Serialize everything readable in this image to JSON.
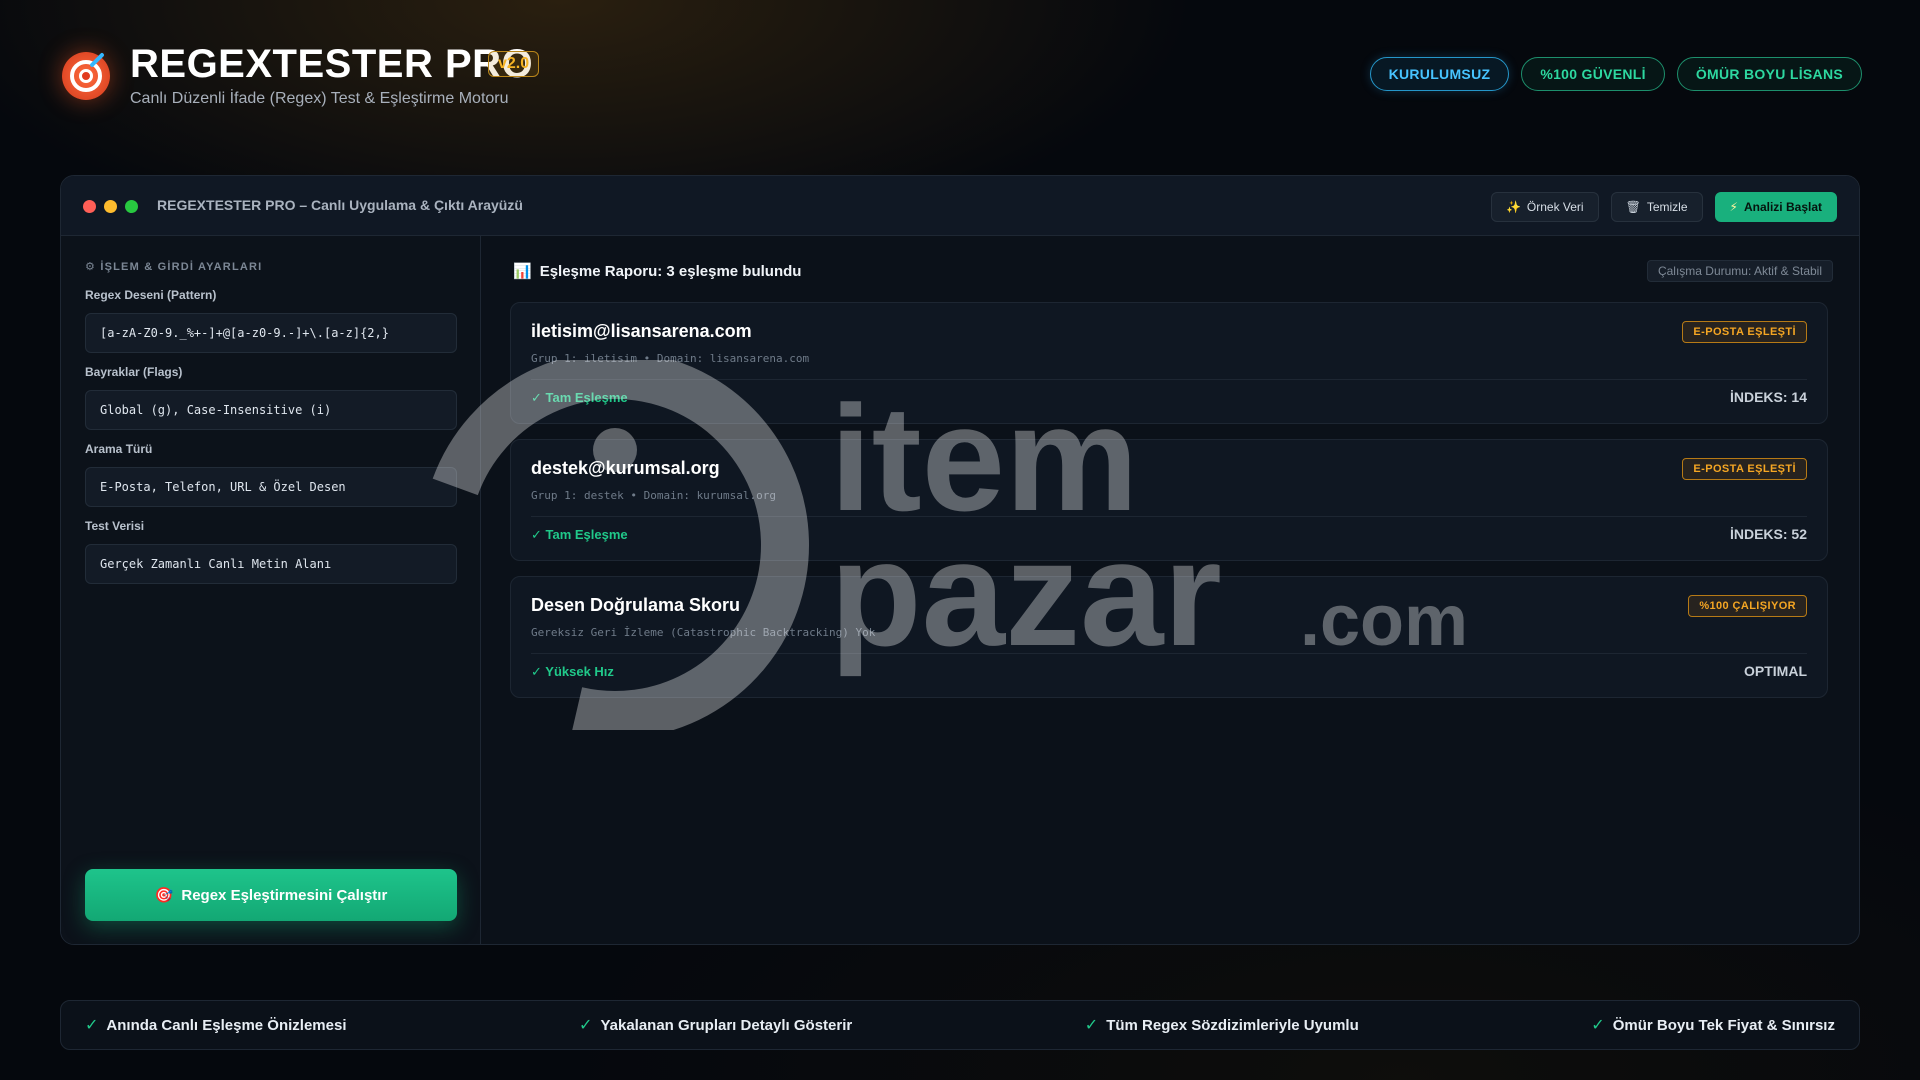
{
  "header": {
    "brand": "REGEXTESTER PRO",
    "version": "v2.0",
    "subtitle": "Canlı Düzenli İfade (Regex) Test & Eşleştirme Motoru",
    "pills": [
      "KURULUMSUZ",
      "%100 GÜVENLİ",
      "ÖMÜR BOYU LİSANS"
    ]
  },
  "window": {
    "title": "REGEXTESTER PRO – Canlı Uygulama & Çıktı Arayüzü",
    "actions": {
      "sample": "Örnek Veri",
      "clear": "Temizle",
      "analyze": "Analizi Başlat"
    }
  },
  "left": {
    "section_title": "İŞLEM & GİRDİ AYARLARI",
    "fields": [
      {
        "label": "Regex Deseni (Pattern)",
        "value": "[a-zA-Z0-9._%+-]+@[a-z0-9.-]+\\.[a-z]{2,}"
      },
      {
        "label": "Bayraklar (Flags)",
        "value": "Global (g), Case-Insensitive (i)"
      },
      {
        "label": "Arama Türü",
        "value": "E-Posta, Telefon, URL & Özel Desen"
      },
      {
        "label": "Test Verisi",
        "value": "Gerçek Zamanlı Canlı Metin Alanı"
      }
    ],
    "run_button": "Regex Eşleştirmesini Çalıştır"
  },
  "right": {
    "report_title": "Eşleşme Raporu: 3 eşleşme bulundu",
    "status": "Çalışma Durumu: Aktif & Stabil",
    "cards": [
      {
        "title": "iletisim@lisansarena.com",
        "meta": "Grup 1: iletisim • Domain: lisansarena.com",
        "status": "✓ Tam Eşleşme",
        "right": "İNDEKS: 14",
        "badge": "E-POSTA EŞLEŞTİ"
      },
      {
        "title": "destek@kurumsal.org",
        "meta": "Grup 1: destek • Domain: kurumsal.org",
        "status": "✓ Tam Eşleşme",
        "right": "İNDEKS: 52",
        "badge": "E-POSTA EŞLEŞTİ"
      },
      {
        "title": "Desen Doğrulama Skoru",
        "meta": "Gereksiz Geri İzleme (Catastrophic Backtracking) Yok",
        "status": "✓ Yüksek Hız",
        "right": "OPTIMAL",
        "badge": "%100 ÇALIŞIYOR"
      }
    ]
  },
  "watermark": {
    "line1": "item",
    "line2": "pazar",
    "suffix": ".com"
  },
  "footer": [
    "Anında Canlı Eşleşme Önizlemesi",
    "Yakalanan Grupları Detaylı Gösterir",
    "Tüm Regex Sözdizimleriyle Uyumlu",
    "Ömür Boyu Tek Fiyat & Sınırsız"
  ],
  "colors": {
    "accent_green": "#19b07d",
    "accent_orange": "#f5a623",
    "accent_blue": "#47c4ff"
  }
}
